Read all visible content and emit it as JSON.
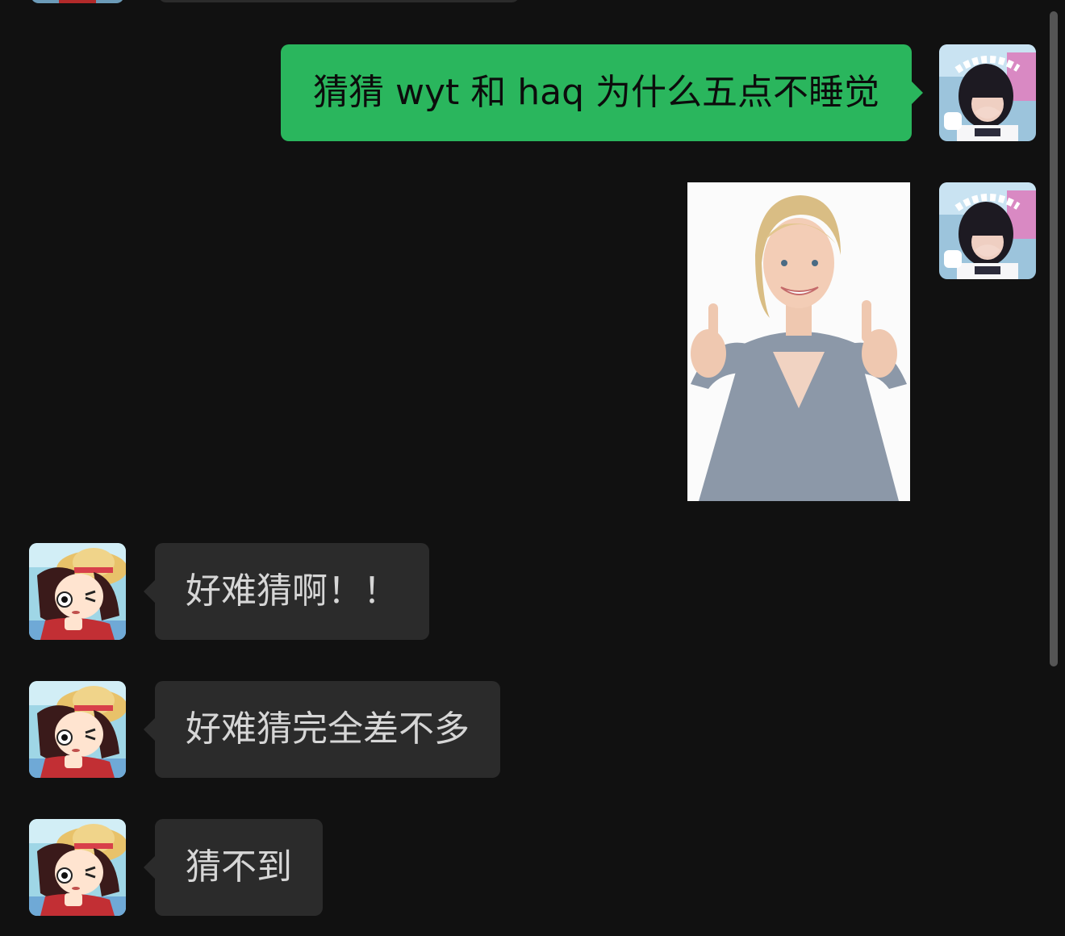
{
  "messages": [
    {
      "sender": "me",
      "type": "text",
      "text": "猜猜 wyt 和 haq 为什么五点不睡觉"
    },
    {
      "sender": "me",
      "type": "image",
      "image_icon": "thumbs-up-woman-photo"
    },
    {
      "sender": "friend",
      "type": "text",
      "text": "好难猜啊！！"
    },
    {
      "sender": "friend",
      "type": "text",
      "text": "好难猜完全差不多"
    },
    {
      "sender": "friend",
      "type": "text",
      "text": "猜不到"
    }
  ],
  "avatars": {
    "me": "maid-girl-avatar-icon",
    "friend": "cartoon-girl-straw-hat-avatar-icon"
  },
  "colors": {
    "background": "#111111",
    "outgoing_bubble": "#2ab65d",
    "incoming_bubble": "#2b2b2b",
    "incoming_text": "#d6d6d6",
    "outgoing_text": "#0c0c0c"
  }
}
